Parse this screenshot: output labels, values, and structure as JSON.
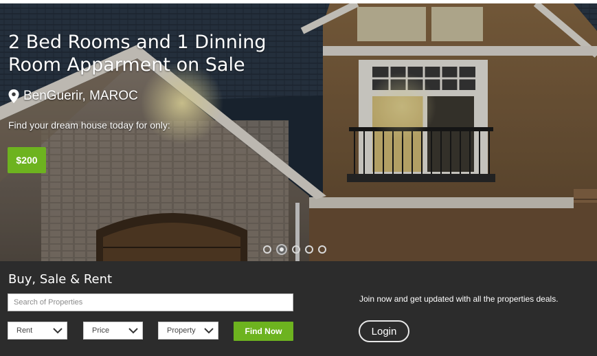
{
  "hero": {
    "title_line1": "2 Bed Rooms and 1 Dinning",
    "title_line2": "Room Apparment on Sale",
    "location": "BenGuerir, MAROC",
    "tagline": "Find your dream house today for only:",
    "price": "$200",
    "slider": {
      "count": 5,
      "active_index": 1
    },
    "pin_icon": "map-pin-icon"
  },
  "search": {
    "title": "Buy, Sale & Rent",
    "placeholder": "Search of Properties",
    "filters": [
      {
        "label": "Rent"
      },
      {
        "label": "Price"
      },
      {
        "label": "Property"
      }
    ],
    "find_label": "Find Now",
    "join_text": "Join now and get updated with all the properties deals.",
    "login_label": "Login"
  },
  "colors": {
    "accent": "#6db31f",
    "panel": "#2c2c2c"
  }
}
